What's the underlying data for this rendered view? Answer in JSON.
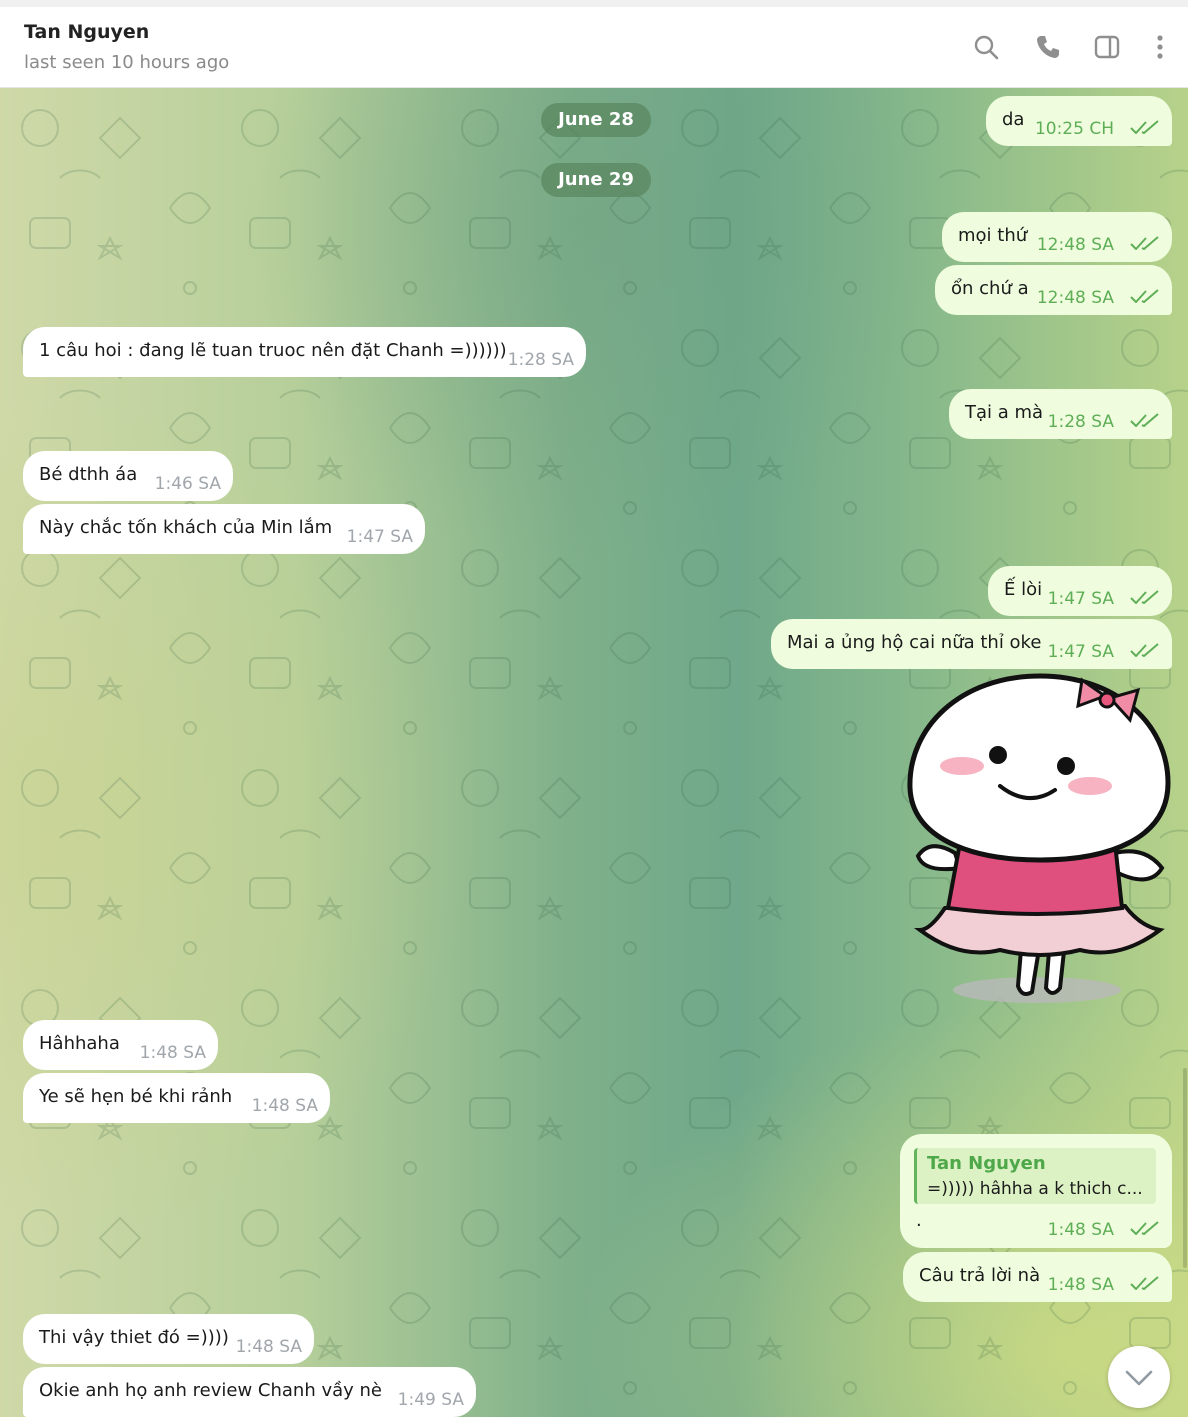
{
  "header": {
    "name": "Tan Nguyen",
    "status": "last seen 10 hours ago",
    "icons": [
      "search-icon",
      "phone-icon",
      "sidebar-toggle-icon",
      "more-vertical-icon"
    ]
  },
  "dates": [
    "June 28",
    "June 29"
  ],
  "messages": [
    {
      "dir": "out",
      "text": "da",
      "time": "10:25 CH"
    },
    {
      "dir": "out",
      "text": "mọi thứ",
      "time": "12:48 SA"
    },
    {
      "dir": "out",
      "text": "ổn chứ a",
      "time": "12:48 SA"
    },
    {
      "dir": "in",
      "text": "1 câu hoi : đang lẽ tuan truoc nên đặt Chanh =))))))",
      "time": "1:28 SA"
    },
    {
      "dir": "out",
      "text": "Tại a mà",
      "time": "1:28 SA"
    },
    {
      "dir": "in",
      "text": "Bé dthh áa",
      "time": "1:46 SA"
    },
    {
      "dir": "in",
      "text": "Này chắc tốn khách của Min lắm",
      "time": "1:47 SA"
    },
    {
      "dir": "out",
      "text": "Ế lòi",
      "time": "1:47 SA"
    },
    {
      "dir": "out",
      "text": "Mai a ủng hộ cai nữa thỉ oke",
      "time": "1:47 SA"
    },
    {
      "dir": "in",
      "text": "Hâhhaha",
      "time": "1:48 SA"
    },
    {
      "dir": "in",
      "text": "Ye sẽ hẹn bé khi rảnh",
      "time": "1:48 SA"
    },
    {
      "dir": "in",
      "text": "Thi vậy thiet đó =))))",
      "time": "1:48 SA"
    },
    {
      "dir": "in",
      "text": "Okie anh họ anh review Chanh vầy nè",
      "time": "1:49 SA"
    }
  ],
  "reply": {
    "quote_name": "Tan Nguyen",
    "quote_text": "=))))) hâhha a k thich c...",
    "text": ".",
    "time": "1:48 SA"
  },
  "last_out": {
    "text": "Câu trả lời nà",
    "time": "1:48 SA"
  },
  "sticker": "smiling-girl-sticker",
  "colors": {
    "outgoing_bubble": "#effdde",
    "incoming_bubble": "#ffffff",
    "outgoing_time": "#5fae57",
    "quote_accent": "#62b55b"
  }
}
